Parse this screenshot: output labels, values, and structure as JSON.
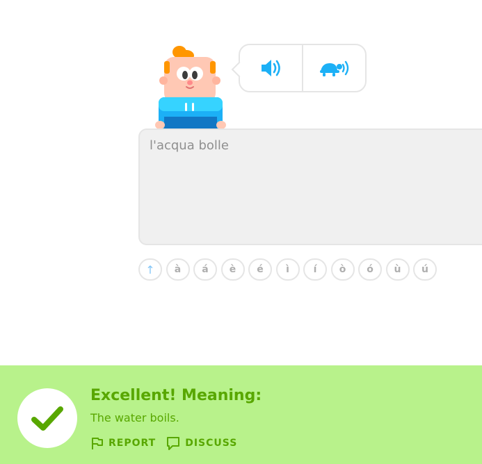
{
  "answer": {
    "text": "l'acqua bolle"
  },
  "audio": {
    "normal_icon": "speaker-icon",
    "slow_icon": "turtle-speaker-icon",
    "accent_color": "#1cb0f6"
  },
  "keyboard": {
    "shift_symbol": "↑",
    "keys": [
      "à",
      "á",
      "è",
      "é",
      "ì",
      "í",
      "ò",
      "ó",
      "ù",
      "ú"
    ]
  },
  "feedback": {
    "title": "Excellent! Meaning:",
    "text": "The water boils.",
    "report_label": "REPORT",
    "discuss_label": "DISCUSS",
    "background_color": "#b8f28b",
    "text_color": "#58a700",
    "check_icon": "checkmark-icon"
  }
}
